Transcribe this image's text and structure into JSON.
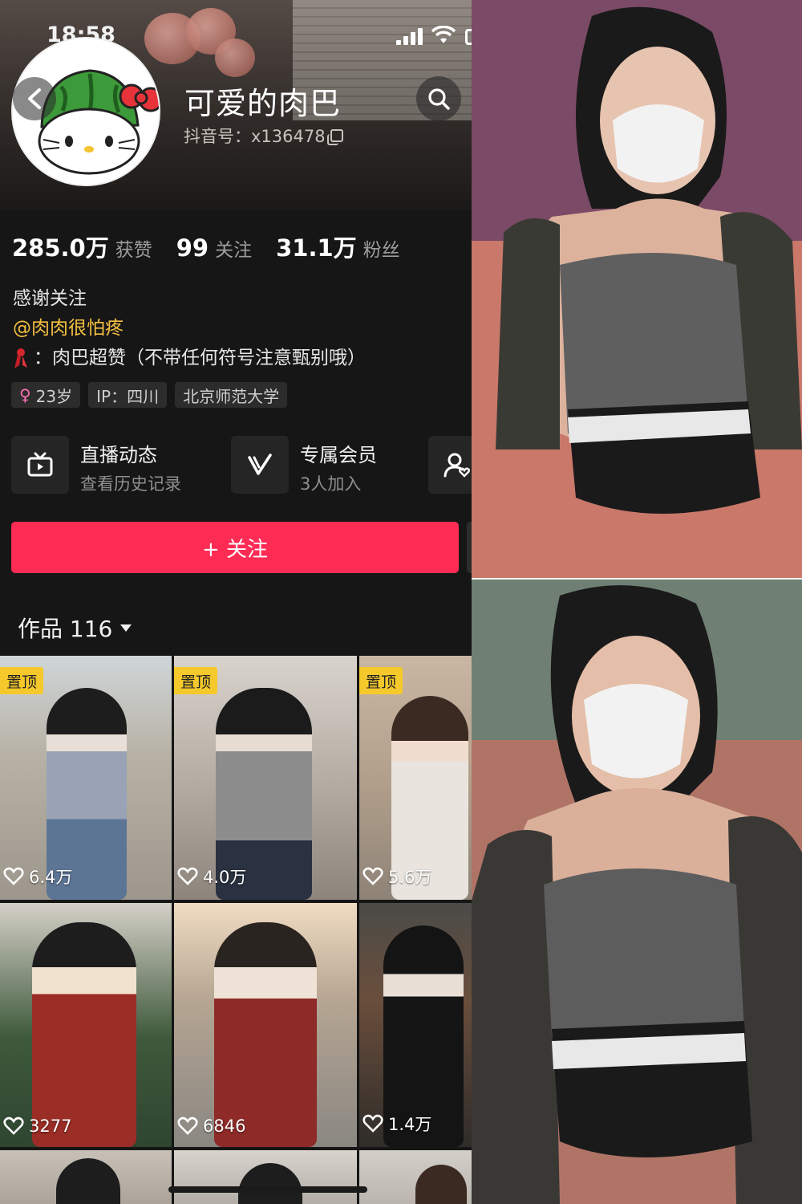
{
  "status_bar": {
    "time": "18:58"
  },
  "profile": {
    "nickname": "可爱的肉巴",
    "douyin_id": "抖音号：x136478"
  },
  "stats": [
    {
      "value": "285.0万",
      "label": "获赞"
    },
    {
      "value": "99",
      "label": "关注"
    },
    {
      "value": "31.1万",
      "label": "粉丝"
    }
  ],
  "bio": {
    "line1": "感谢关注",
    "mention": "@肉肉很怕疼",
    "line3": "：肉巴超赞（不带任何符号注意甄别哦）"
  },
  "tags": [
    {
      "icon": "female-icon",
      "text": "23岁"
    },
    {
      "text": "IP：四川"
    },
    {
      "text": "北京师范大学"
    }
  ],
  "features": [
    {
      "icon": "live-tv-icon",
      "title": "直播动态",
      "subtitle": "查看历史记录"
    },
    {
      "icon": "vip-v-icon",
      "title": "专属会员",
      "subtitle": "3人加入"
    },
    {
      "icon": "add-friend-icon"
    }
  ],
  "follow_button": {
    "label": "+ 关注"
  },
  "works": {
    "title": "作品 116"
  },
  "videos": [
    {
      "pinned": "置顶",
      "likes": "6.4万"
    },
    {
      "pinned": "置顶",
      "likes": "4.0万"
    },
    {
      "pinned": "置顶",
      "likes": "5.6万"
    },
    {
      "likes": "3277"
    },
    {
      "likes": "6846"
    },
    {
      "likes": "1.4万"
    }
  ],
  "colors": {
    "follow_button": "#fe2c55",
    "pinned_badge": "#f5c92c",
    "mention": "#f5c042",
    "background": "#161616"
  }
}
